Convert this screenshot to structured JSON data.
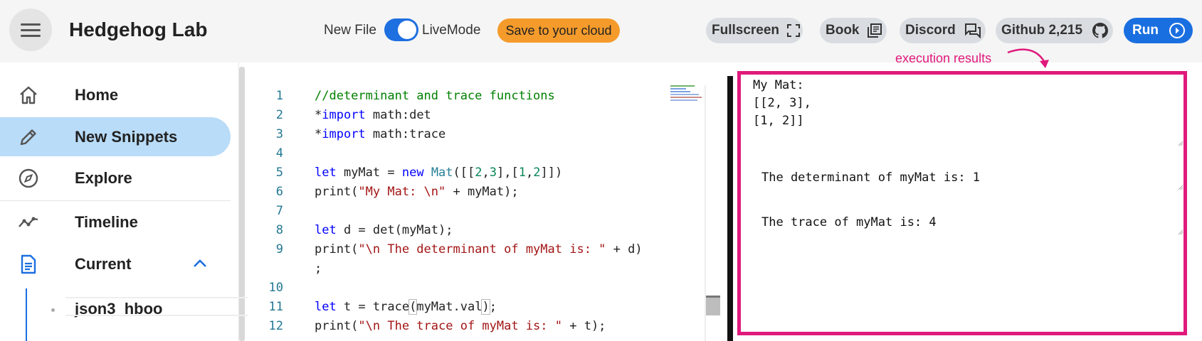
{
  "header": {
    "title": "Hedgehog Lab",
    "new_file": "New File",
    "live_mode": "LiveMode",
    "save_label": "Save to your cloud",
    "fullscreen_label": "Fullscreen",
    "book_label": "Book",
    "discord_label": "Discord",
    "github_label": "Github 2,215",
    "run_label": "Run",
    "live_mode_on": true
  },
  "annotation": "execution results",
  "sidebar": {
    "items": [
      {
        "label": "Home",
        "icon": "home-icon"
      },
      {
        "label": "New Snippets",
        "icon": "pencil-icon"
      },
      {
        "label": "Explore",
        "icon": "compass-icon"
      },
      {
        "label": "Timeline",
        "icon": "timeline-icon"
      },
      {
        "label": "Current",
        "icon": "document-icon"
      }
    ],
    "sub_items": [
      "json3_hboo"
    ]
  },
  "editor": {
    "lines": [
      {
        "n": "1",
        "text": "//determinant and trace functions"
      },
      {
        "n": "2",
        "text": "*import math:det"
      },
      {
        "n": "3",
        "text": "*import math:trace"
      },
      {
        "n": "4",
        "text": ""
      },
      {
        "n": "5",
        "text": "let myMat = new Mat([[2,3],[1,2]])"
      },
      {
        "n": "6",
        "text": "print(\"My Mat: \\n\" + myMat);"
      },
      {
        "n": "7",
        "text": ""
      },
      {
        "n": "8",
        "text": "let d = det(myMat);"
      },
      {
        "n": "9",
        "text": "print(\"\\n The determinant of myMat is: \" + d)"
      },
      {
        "n": "",
        "text": ";"
      },
      {
        "n": "10",
        "text": ""
      },
      {
        "n": "11",
        "text": "let t = trace(myMat.val);"
      },
      {
        "n": "12",
        "text": "print(\"\\n The trace of myMat is: \" + t);"
      }
    ]
  },
  "results": {
    "block1": [
      "My Mat:",
      "[[2, 3],",
      "[1, 2]]"
    ],
    "block2": "The determinant of myMat is: 1",
    "block3": "The trace of myMat is: 4"
  },
  "colors": {
    "accent_blue": "#1a6fe0",
    "save_orange": "#f59b2b",
    "annotation_pink": "#e0197c",
    "active_nav": "#b9dcf8"
  }
}
